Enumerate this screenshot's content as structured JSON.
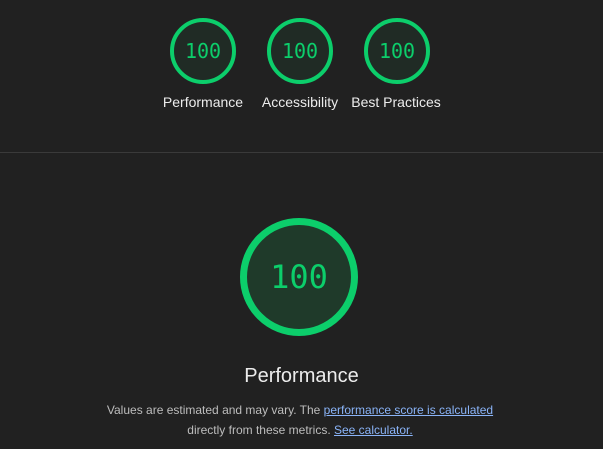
{
  "top_gauges": [
    {
      "score": "100",
      "label": "Performance"
    },
    {
      "score": "100",
      "label": "Accessibility"
    },
    {
      "score": "100",
      "label": "Best Practices"
    }
  ],
  "main": {
    "score": "100",
    "title": "Performance",
    "desc_line1": "Values are estimated and may vary. The ",
    "desc_link1": "performance score is calculated",
    "desc_line2": "directly from these metrics. ",
    "desc_link2": "See calculator."
  },
  "colors": {
    "pass": "#0cce6b",
    "background": "#212121",
    "link": "#8ab4f8"
  }
}
